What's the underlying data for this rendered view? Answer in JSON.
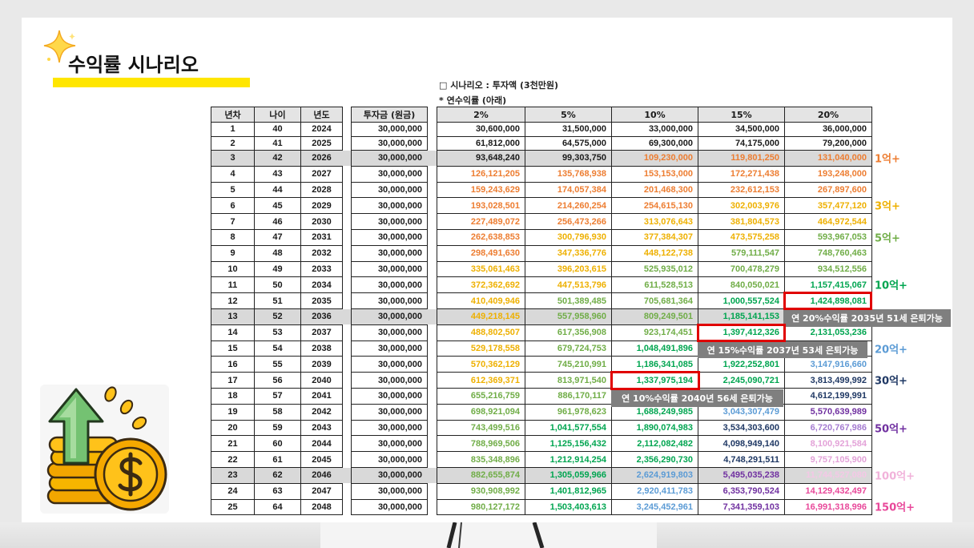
{
  "slide": {
    "title": "수익률 시나리오"
  },
  "notes": {
    "scenario": "□ 시나리오 : 투자액 (3천만원)",
    "rate_note": "* 연수익률 (아래)"
  },
  "icons": {
    "title_icon": "sparkle-icon",
    "illustration": "coin-growth-icon"
  },
  "colors": {
    "title_underline": "#ffe600",
    "header_bg": "#e4e4e4",
    "shaded_row": "#d9d9d9",
    "callout_bg": "#7f7f7f",
    "highlight_border": "#e00000"
  },
  "palette": {
    "black": "#1a1a1a",
    "orange": "#ed7d31",
    "gold": "#eeb000",
    "green": "#70ad47",
    "dgreen": "#00a550",
    "blue": "#5b9bd5",
    "navy": "#1f3864",
    "purple": "#7030a0",
    "lpurple": "#a47bd0",
    "lpink": "#e3a2d8",
    "vlpink": "#f4c8e6",
    "pink": "#e8489a"
  },
  "table": {
    "headers": {
      "year_no": "년차",
      "age": "나이",
      "year": "년도",
      "principal": "투자금 (원금)",
      "rates": [
        "2%",
        "5%",
        "10%",
        "15%",
        "20%"
      ]
    },
    "rows": [
      {
        "n": "1",
        "age": "40",
        "year": "2024",
        "principal": "30,000,000",
        "shaded": false,
        "values": [
          {
            "v": "30,600,000",
            "c": "black"
          },
          {
            "v": "31,500,000",
            "c": "black"
          },
          {
            "v": "33,000,000",
            "c": "black"
          },
          {
            "v": "34,500,000",
            "c": "black"
          },
          {
            "v": "36,000,000",
            "c": "black"
          }
        ]
      },
      {
        "n": "2",
        "age": "41",
        "year": "2025",
        "principal": "30,000,000",
        "shaded": false,
        "values": [
          {
            "v": "61,812,000",
            "c": "black"
          },
          {
            "v": "64,575,000",
            "c": "black"
          },
          {
            "v": "69,300,000",
            "c": "black"
          },
          {
            "v": "74,175,000",
            "c": "black"
          },
          {
            "v": "79,200,000",
            "c": "black"
          }
        ]
      },
      {
        "n": "3",
        "age": "42",
        "year": "2026",
        "principal": "30,000,000",
        "shaded": true,
        "values": [
          {
            "v": "93,648,240",
            "c": "black"
          },
          {
            "v": "99,303,750",
            "c": "black"
          },
          {
            "v": "109,230,000",
            "c": "orange"
          },
          {
            "v": "119,801,250",
            "c": "orange"
          },
          {
            "v": "131,040,000",
            "c": "orange"
          }
        ]
      },
      {
        "n": "4",
        "age": "43",
        "year": "2027",
        "principal": "30,000,000",
        "shaded": false,
        "values": [
          {
            "v": "126,121,205",
            "c": "orange"
          },
          {
            "v": "135,768,938",
            "c": "orange"
          },
          {
            "v": "153,153,000",
            "c": "orange"
          },
          {
            "v": "172,271,438",
            "c": "orange"
          },
          {
            "v": "193,248,000",
            "c": "orange"
          }
        ]
      },
      {
        "n": "5",
        "age": "44",
        "year": "2028",
        "principal": "30,000,000",
        "shaded": false,
        "values": [
          {
            "v": "159,243,629",
            "c": "orange"
          },
          {
            "v": "174,057,384",
            "c": "orange"
          },
          {
            "v": "201,468,300",
            "c": "orange"
          },
          {
            "v": "232,612,153",
            "c": "orange"
          },
          {
            "v": "267,897,600",
            "c": "orange"
          }
        ]
      },
      {
        "n": "6",
        "age": "45",
        "year": "2029",
        "principal": "30,000,000",
        "shaded": false,
        "values": [
          {
            "v": "193,028,501",
            "c": "orange"
          },
          {
            "v": "214,260,254",
            "c": "orange"
          },
          {
            "v": "254,615,130",
            "c": "orange"
          },
          {
            "v": "302,003,976",
            "c": "gold"
          },
          {
            "v": "357,477,120",
            "c": "gold"
          }
        ]
      },
      {
        "n": "7",
        "age": "46",
        "year": "2030",
        "principal": "30,000,000",
        "shaded": false,
        "values": [
          {
            "v": "227,489,072",
            "c": "orange"
          },
          {
            "v": "256,473,266",
            "c": "orange"
          },
          {
            "v": "313,076,643",
            "c": "gold"
          },
          {
            "v": "381,804,573",
            "c": "gold"
          },
          {
            "v": "464,972,544",
            "c": "gold"
          }
        ]
      },
      {
        "n": "8",
        "age": "47",
        "year": "2031",
        "principal": "30,000,000",
        "shaded": false,
        "values": [
          {
            "v": "262,638,853",
            "c": "orange"
          },
          {
            "v": "300,796,930",
            "c": "gold"
          },
          {
            "v": "377,384,307",
            "c": "gold"
          },
          {
            "v": "473,575,258",
            "c": "gold"
          },
          {
            "v": "593,967,053",
            "c": "green"
          }
        ]
      },
      {
        "n": "9",
        "age": "48",
        "year": "2032",
        "principal": "30,000,000",
        "shaded": false,
        "values": [
          {
            "v": "298,491,630",
            "c": "orange"
          },
          {
            "v": "347,336,776",
            "c": "gold"
          },
          {
            "v": "448,122,738",
            "c": "gold"
          },
          {
            "v": "579,111,547",
            "c": "green"
          },
          {
            "v": "748,760,463",
            "c": "green"
          }
        ]
      },
      {
        "n": "10",
        "age": "49",
        "year": "2033",
        "principal": "30,000,000",
        "shaded": false,
        "values": [
          {
            "v": "335,061,463",
            "c": "gold"
          },
          {
            "v": "396,203,615",
            "c": "gold"
          },
          {
            "v": "525,935,012",
            "c": "green"
          },
          {
            "v": "700,478,279",
            "c": "green"
          },
          {
            "v": "934,512,556",
            "c": "green"
          }
        ]
      },
      {
        "n": "11",
        "age": "50",
        "year": "2034",
        "principal": "30,000,000",
        "shaded": false,
        "values": [
          {
            "v": "372,362,692",
            "c": "gold"
          },
          {
            "v": "447,513,796",
            "c": "gold"
          },
          {
            "v": "611,528,513",
            "c": "green"
          },
          {
            "v": "840,050,021",
            "c": "green"
          },
          {
            "v": "1,157,415,067",
            "c": "dgreen"
          }
        ]
      },
      {
        "n": "12",
        "age": "51",
        "year": "2035",
        "principal": "30,000,000",
        "shaded": false,
        "values": [
          {
            "v": "410,409,946",
            "c": "gold"
          },
          {
            "v": "501,389,485",
            "c": "green"
          },
          {
            "v": "705,681,364",
            "c": "green"
          },
          {
            "v": "1,000,557,524",
            "c": "dgreen"
          },
          {
            "v": "1,424,898,081",
            "c": "dgreen"
          }
        ]
      },
      {
        "n": "13",
        "age": "52",
        "year": "2036",
        "principal": "30,000,000",
        "shaded": true,
        "values": [
          {
            "v": "449,218,145",
            "c": "gold"
          },
          {
            "v": "557,958,960",
            "c": "green"
          },
          {
            "v": "809,249,501",
            "c": "green"
          },
          {
            "v": "1,185,141,153",
            "c": "dgreen"
          },
          {
            "v": null,
            "c": null
          }
        ]
      },
      {
        "n": "14",
        "age": "53",
        "year": "2037",
        "principal": "30,000,000",
        "shaded": false,
        "values": [
          {
            "v": "488,802,507",
            "c": "gold"
          },
          {
            "v": "617,356,908",
            "c": "green"
          },
          {
            "v": "923,174,451",
            "c": "green"
          },
          {
            "v": "1,397,412,326",
            "c": "dgreen"
          },
          {
            "v": "2,131,053,236",
            "c": "dgreen"
          }
        ]
      },
      {
        "n": "15",
        "age": "54",
        "year": "2038",
        "principal": "30,000,000",
        "shaded": false,
        "values": [
          {
            "v": "529,178,558",
            "c": "gold"
          },
          {
            "v": "679,724,753",
            "c": "green"
          },
          {
            "v": "1,048,491,896",
            "c": "dgreen"
          },
          {
            "v": null,
            "c": null
          },
          {
            "v": null,
            "c": null
          }
        ]
      },
      {
        "n": "16",
        "age": "55",
        "year": "2039",
        "principal": "30,000,000",
        "shaded": false,
        "values": [
          {
            "v": "570,362,129",
            "c": "gold"
          },
          {
            "v": "745,210,991",
            "c": "green"
          },
          {
            "v": "1,186,341,085",
            "c": "dgreen"
          },
          {
            "v": "1,922,252,801",
            "c": "dgreen"
          },
          {
            "v": "3,147,916,660",
            "c": "blue"
          }
        ]
      },
      {
        "n": "17",
        "age": "56",
        "year": "2040",
        "principal": "30,000,000",
        "shaded": false,
        "values": [
          {
            "v": "612,369,371",
            "c": "gold"
          },
          {
            "v": "813,971,540",
            "c": "green"
          },
          {
            "v": "1,337,975,194",
            "c": "dgreen"
          },
          {
            "v": "2,245,090,721",
            "c": "dgreen"
          },
          {
            "v": "3,813,499,992",
            "c": "navy"
          }
        ]
      },
      {
        "n": "18",
        "age": "57",
        "year": "2041",
        "principal": "30,000,000",
        "shaded": false,
        "values": [
          {
            "v": "655,216,759",
            "c": "green"
          },
          {
            "v": "886,170,117",
            "c": "green"
          },
          {
            "v": null,
            "c": null
          },
          {
            "v": null,
            "c": null
          },
          {
            "v": "4,612,199,991",
            "c": "navy"
          }
        ]
      },
      {
        "n": "19",
        "age": "58",
        "year": "2042",
        "principal": "30,000,000",
        "shaded": false,
        "values": [
          {
            "v": "698,921,094",
            "c": "green"
          },
          {
            "v": "961,978,623",
            "c": "green"
          },
          {
            "v": "1,688,249,985",
            "c": "dgreen"
          },
          {
            "v": "3,043,307,479",
            "c": "blue"
          },
          {
            "v": "5,570,639,989",
            "c": "purple"
          }
        ]
      },
      {
        "n": "20",
        "age": "59",
        "year": "2043",
        "principal": "30,000,000",
        "shaded": false,
        "values": [
          {
            "v": "743,499,516",
            "c": "green"
          },
          {
            "v": "1,041,577,554",
            "c": "dgreen"
          },
          {
            "v": "1,890,074,983",
            "c": "dgreen"
          },
          {
            "v": "3,534,303,600",
            "c": "navy"
          },
          {
            "v": "6,720,767,986",
            "c": "lpurple"
          }
        ]
      },
      {
        "n": "21",
        "age": "60",
        "year": "2044",
        "principal": "30,000,000",
        "shaded": false,
        "values": [
          {
            "v": "788,969,506",
            "c": "green"
          },
          {
            "v": "1,125,156,432",
            "c": "dgreen"
          },
          {
            "v": "2,112,082,482",
            "c": "dgreen"
          },
          {
            "v": "4,098,949,140",
            "c": "navy"
          },
          {
            "v": "8,100,921,584",
            "c": "lpink"
          }
        ]
      },
      {
        "n": "22",
        "age": "61",
        "year": "2045",
        "principal": "30,000,000",
        "shaded": false,
        "values": [
          {
            "v": "835,348,896",
            "c": "green"
          },
          {
            "v": "1,212,914,254",
            "c": "dgreen"
          },
          {
            "v": "2,356,290,730",
            "c": "dgreen"
          },
          {
            "v": "4,748,291,511",
            "c": "navy"
          },
          {
            "v": "9,757,105,900",
            "c": "lpink"
          }
        ]
      },
      {
        "n": "23",
        "age": "62",
        "year": "2046",
        "principal": "30,000,000",
        "shaded": true,
        "values": [
          {
            "v": "882,655,874",
            "c": "green"
          },
          {
            "v": "1,305,059,966",
            "c": "dgreen"
          },
          {
            "v": "2,624,919,803",
            "c": "blue"
          },
          {
            "v": "5,495,035,238",
            "c": "purple"
          },
          {
            "v": "11,744,527,080",
            "c": "vlpink"
          }
        ]
      },
      {
        "n": "24",
        "age": "63",
        "year": "2047",
        "principal": "30,000,000",
        "shaded": false,
        "values": [
          {
            "v": "930,908,992",
            "c": "green"
          },
          {
            "v": "1,401,812,965",
            "c": "dgreen"
          },
          {
            "v": "2,920,411,783",
            "c": "blue"
          },
          {
            "v": "6,353,790,524",
            "c": "purple"
          },
          {
            "v": "14,129,432,497",
            "c": "pink"
          }
        ]
      },
      {
        "n": "25",
        "age": "64",
        "year": "2048",
        "principal": "30,000,000",
        "shaded": false,
        "values": [
          {
            "v": "980,127,172",
            "c": "green"
          },
          {
            "v": "1,503,403,613",
            "c": "dgreen"
          },
          {
            "v": "3,245,452,961",
            "c": "blue"
          },
          {
            "v": "7,341,359,103",
            "c": "purple"
          },
          {
            "v": "16,991,318,996",
            "c": "pink"
          }
        ]
      }
    ]
  },
  "tier_labels": [
    {
      "text": "1억+",
      "color": "#ed7d31"
    },
    {
      "text": "3억+",
      "color": "#eeb000"
    },
    {
      "text": "5억+",
      "color": "#70ad47"
    },
    {
      "text": "10억+",
      "color": "#00a550"
    },
    {
      "text": "20억+",
      "color": "#5b9bd5"
    },
    {
      "text": "30억+",
      "color": "#1f3864"
    },
    {
      "text": "50억+",
      "color": "#7030a0"
    },
    {
      "text": "100억+",
      "color": "#f1b2da"
    },
    {
      "text": "150억+",
      "color": "#e8489a"
    }
  ],
  "callouts": [
    {
      "text": "연 20%수익률 2035년 51세 은퇴가능"
    },
    {
      "text": "연 15%수익률 2037년 53세 은퇴가능"
    },
    {
      "text": "연 10%수익률 2040년 56세 은퇴가능"
    }
  ]
}
